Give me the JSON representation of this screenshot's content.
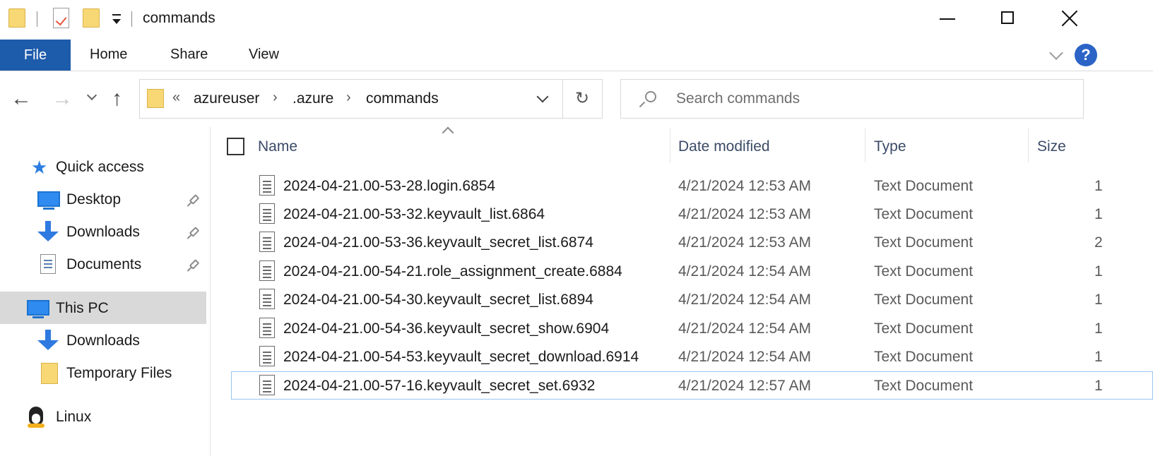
{
  "window": {
    "title": "commands"
  },
  "ribbon": {
    "file_tab": "File",
    "tabs": [
      "Home",
      "Share",
      "View"
    ],
    "help_label": "?"
  },
  "address": {
    "overflow": "«",
    "crumbs": [
      "azureuser",
      ".azure",
      "commands"
    ],
    "separator": "›"
  },
  "search": {
    "placeholder": "Search commands"
  },
  "nav": {
    "quick_access": "Quick access",
    "pinned": [
      "Desktop",
      "Downloads",
      "Documents"
    ],
    "this_pc": "This PC",
    "pc_items": [
      "Downloads",
      "Temporary Files"
    ],
    "linux": "Linux"
  },
  "columns": {
    "name": "Name",
    "date": "Date modified",
    "type": "Type",
    "size": "Size"
  },
  "files": [
    {
      "name": "2024-04-21.00-53-28.login.6854",
      "date": "4/21/2024 12:53 AM",
      "type": "Text Document",
      "size": "1"
    },
    {
      "name": "2024-04-21.00-53-32.keyvault_list.6864",
      "date": "4/21/2024 12:53 AM",
      "type": "Text Document",
      "size": "1"
    },
    {
      "name": "2024-04-21.00-53-36.keyvault_secret_list.6874",
      "date": "4/21/2024 12:53 AM",
      "type": "Text Document",
      "size": "2"
    },
    {
      "name": "2024-04-21.00-54-21.role_assignment_create.6884",
      "date": "4/21/2024 12:54 AM",
      "type": "Text Document",
      "size": "1"
    },
    {
      "name": "2024-04-21.00-54-30.keyvault_secret_list.6894",
      "date": "4/21/2024 12:54 AM",
      "type": "Text Document",
      "size": "1"
    },
    {
      "name": "2024-04-21.00-54-36.keyvault_secret_show.6904",
      "date": "4/21/2024 12:54 AM",
      "type": "Text Document",
      "size": "1"
    },
    {
      "name": "2024-04-21.00-54-53.keyvault_secret_download.6914",
      "date": "4/21/2024 12:54 AM",
      "type": "Text Document",
      "size": "1"
    },
    {
      "name": "2024-04-21.00-57-16.keyvault_secret_set.6932",
      "date": "4/21/2024 12:57 AM",
      "type": "Text Document",
      "size": "1"
    }
  ],
  "colors": {
    "file_tab_bg": "#1d5bab",
    "selection_outline": "#99c6f0",
    "nav_selected_bg": "#d9d9d9",
    "folder_yellow": "#f8d775",
    "icon_blue": "#2e7ae0"
  }
}
